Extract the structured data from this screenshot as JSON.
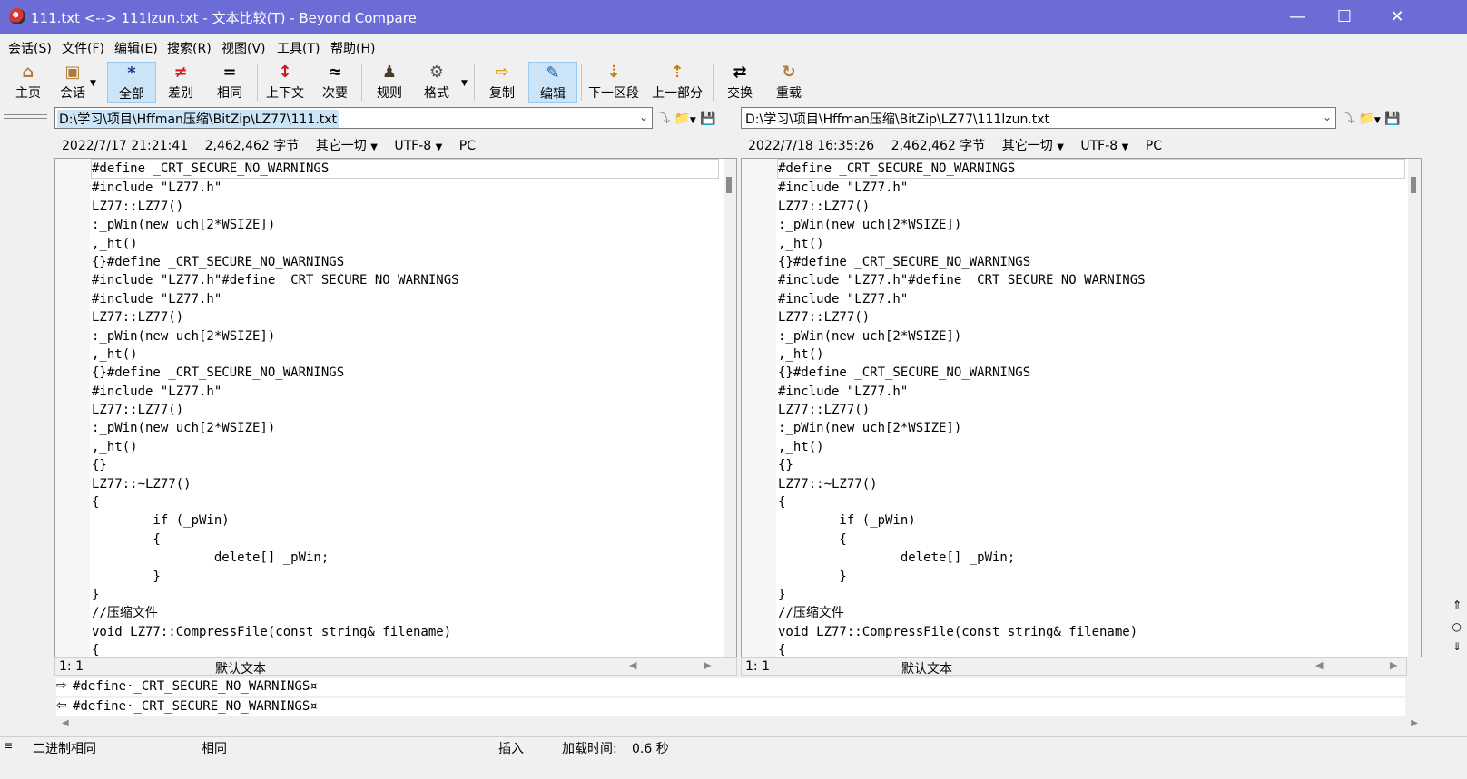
{
  "window": {
    "title": "111.txt <--> 111lzun.txt - 文本比较(T) - Beyond Compare"
  },
  "menu": [
    "会话(S)",
    "文件(F)",
    "编辑(E)",
    "搜索(R)",
    "视图(V)",
    "工具(T)",
    "帮助(H)"
  ],
  "toolbar": {
    "home": "主页",
    "session": "会话",
    "all": "全部",
    "diff": "差别",
    "same": "相同",
    "context": "上下文",
    "minor": "次要",
    "rules": "规则",
    "format": "格式",
    "copy": "复制",
    "edit": "编辑",
    "next_section": "下一区段",
    "prev_section": "上一部分",
    "swap": "交换",
    "reload": "重载"
  },
  "left": {
    "path": "D:\\学习\\项目\\Hffman压缩\\BitZip\\LZ77\\111.txt",
    "date": "2022/7/17 21:21:41",
    "size": "2,462,462 字节",
    "filter": "其它一切",
    "encoding": "UTF-8",
    "eol": "PC",
    "cursor": "1: 1",
    "syntax": "默认文本"
  },
  "right": {
    "path": "D:\\学习\\项目\\Hffman压缩\\BitZip\\LZ77\\111lzun.txt",
    "date": "2022/7/18 16:35:26",
    "size": "2,462,462 字节",
    "filter": "其它一切",
    "encoding": "UTF-8",
    "eol": "PC",
    "cursor": "1: 1",
    "syntax": "默认文本"
  },
  "code_lines": [
    "#define _CRT_SECURE_NO_WARNINGS",
    "#include \"LZ77.h\"",
    "LZ77::LZ77()",
    ":_pWin(new uch[2*WSIZE])",
    ",_ht()",
    "{}#define _CRT_SECURE_NO_WARNINGS",
    "#include \"LZ77.h\"#define _CRT_SECURE_NO_WARNINGS",
    "#include \"LZ77.h\"",
    "LZ77::LZ77()",
    ":_pWin(new uch[2*WSIZE])",
    ",_ht()",
    "{}#define _CRT_SECURE_NO_WARNINGS",
    "#include \"LZ77.h\"",
    "LZ77::LZ77()",
    ":_pWin(new uch[2*WSIZE])",
    ",_ht()",
    "{}",
    "LZ77::~LZ77()",
    "{",
    "        if (_pWin)",
    "        {",
    "                delete[] _pWin;",
    "        }",
    "}",
    "//压缩文件",
    "void LZ77::CompressFile(const string& filename)",
    "{"
  ],
  "compare_lines": {
    "top": "#define·_CRT_SECURE_NO_WARNINGS¤",
    "bottom": "#define·_CRT_SECURE_NO_WARNINGS¤"
  },
  "statusbar": {
    "binary": "二进制相同",
    "same": "相同",
    "mode": "插入",
    "load_label": "加载时间:",
    "load_value": "0.6 秒"
  }
}
